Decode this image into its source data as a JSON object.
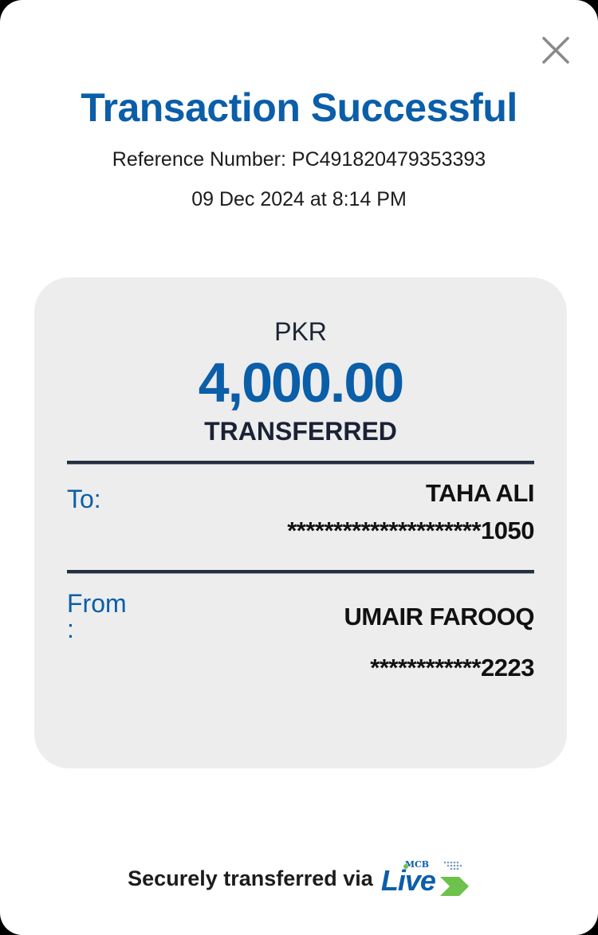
{
  "dialog": {
    "title": "Transaction Successful",
    "reference": "Reference Number: PC491820479353393",
    "datetime": "09 Dec 2024 at 8:14 PM",
    "close_icon": "close-icon"
  },
  "receipt": {
    "currency": "PKR",
    "amount": "4,000.00",
    "status": "TRANSFERRED",
    "to_label": "To:",
    "to_name": "TAHA ALI",
    "to_account": "*********************1050",
    "from_label": "From\n:",
    "from_name": "UMAIR FAROOQ",
    "from_account": "************2223"
  },
  "footer": {
    "text": "Securely transferred via",
    "logo_small": "MCB",
    "logo_main": "Live"
  },
  "colors": {
    "accent": "#0b5ea8",
    "card_bg": "#ededee",
    "logo_green": "#6cc24a"
  }
}
